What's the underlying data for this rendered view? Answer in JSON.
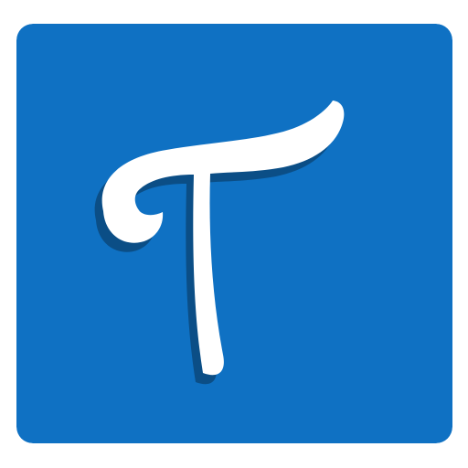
{
  "icon": {
    "semantic": "letter-t-logo-icon",
    "background_color": "#0F71C3",
    "glyph_color": "#FFFFFF",
    "shadow_color": "#0B4E86",
    "glyph_letter": "T"
  }
}
